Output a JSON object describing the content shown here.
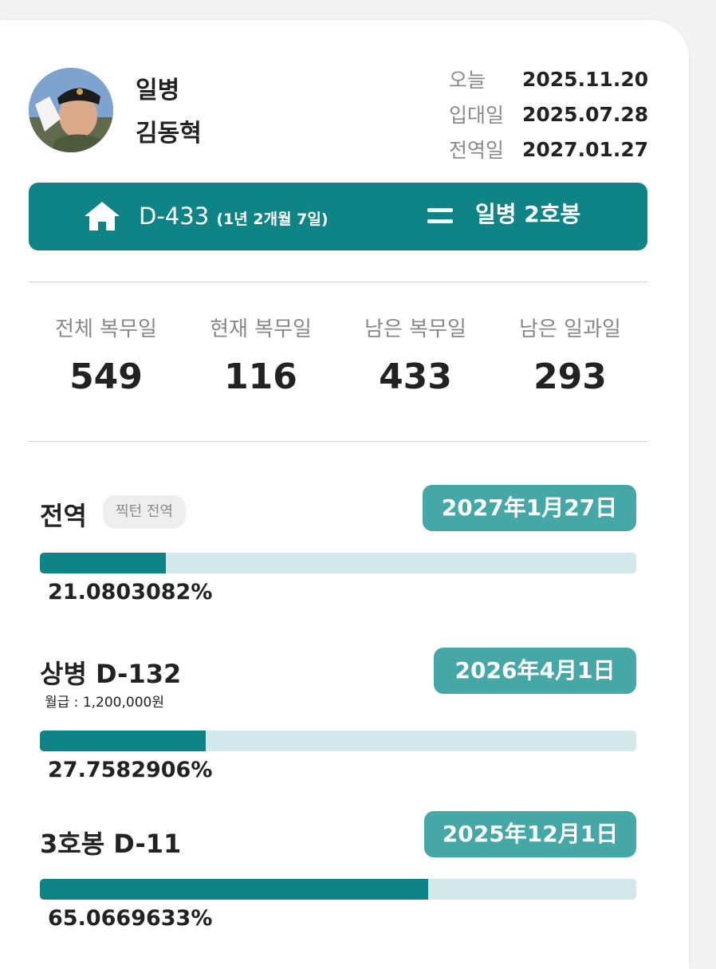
{
  "profile": {
    "rank": "일병",
    "name": "김동혁"
  },
  "dates": [
    {
      "label": "오늘",
      "value": "2025.11.20"
    },
    {
      "label": "입대일",
      "value": "2025.07.28"
    },
    {
      "label": "전역일",
      "value": "2027.01.27"
    }
  ],
  "banner": {
    "d_count": "D-433",
    "d_detail": "(1년 2개월 7일)",
    "rank_step": "일병 2호봉",
    "color": "#0e8487"
  },
  "stats": [
    {
      "label": "전체 복무일",
      "value": "549"
    },
    {
      "label": "현재 복무일",
      "value": "116"
    },
    {
      "label": "남은 복무일",
      "value": "433"
    },
    {
      "label": "남은 일과일",
      "value": "293"
    }
  ],
  "milestones": [
    {
      "title": "전역",
      "tag": "찍턴 전역",
      "date": "2027年1月27日",
      "percent_text": "21.0803082%",
      "percent": 21.0803082
    },
    {
      "title": "상병 D-132",
      "sub": "월급 : 1,200,000원",
      "date": "2026年4月1日",
      "percent_text": "27.7582906%",
      "percent": 27.7582906
    },
    {
      "title": "3호봉 D-11",
      "date": "2025年12月1日",
      "percent_text": "65.0669633%",
      "percent": 65.0669633
    }
  ],
  "colors": {
    "accent": "#0e8487",
    "pill": "#46a7a7",
    "track": "#d2e8ea"
  }
}
